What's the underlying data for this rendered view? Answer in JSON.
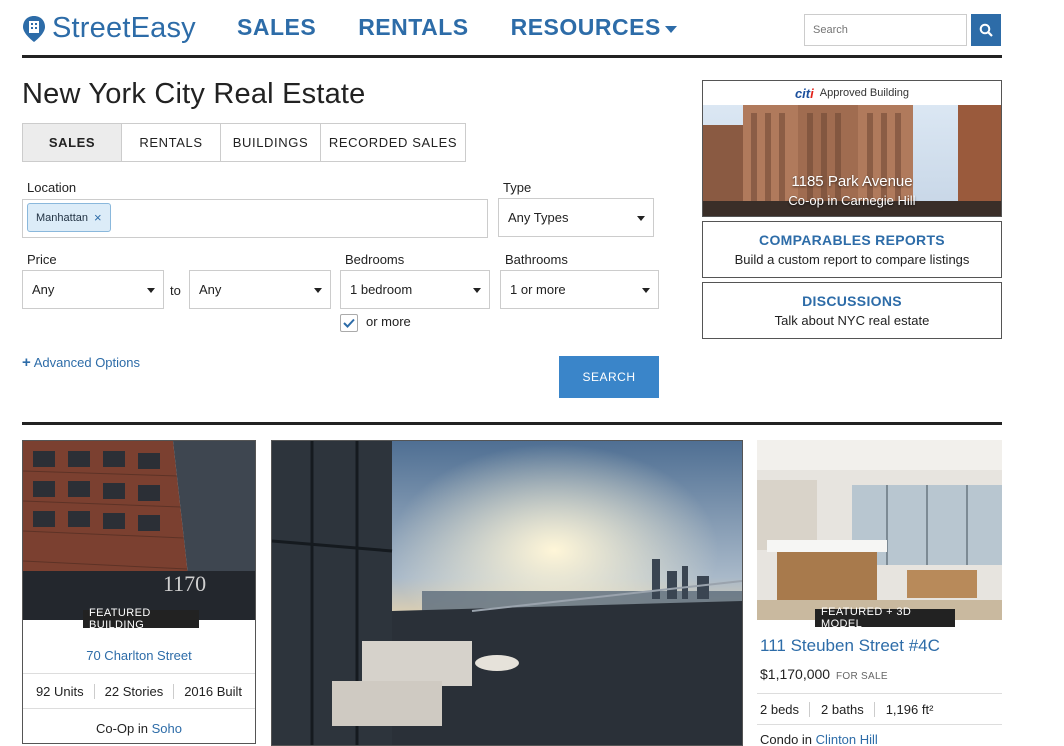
{
  "header": {
    "logo": "StreetEasy",
    "nav": [
      {
        "label": "SALES"
      },
      {
        "label": "RENTALS"
      },
      {
        "label": "RESOURCES"
      }
    ],
    "search_placeholder": "Search"
  },
  "page_title": "New York City Real Estate",
  "tabs": [
    {
      "label": "SALES",
      "active": true
    },
    {
      "label": "RENTALS",
      "active": false
    },
    {
      "label": "BUILDINGS",
      "active": false
    },
    {
      "label": "RECORDED SALES",
      "active": false
    }
  ],
  "form": {
    "location_label": "Location",
    "location_chip": "Manhattan",
    "type_label": "Type",
    "type_value": "Any Types",
    "price_label": "Price",
    "price_min": "Any",
    "to_label": "to",
    "price_max": "Any",
    "bedrooms_label": "Bedrooms",
    "bedrooms_value": "1 bedroom",
    "or_more_label": "or more",
    "or_more_checked": true,
    "bathrooms_label": "Bathrooms",
    "bathrooms_value": "1 or more",
    "advanced_label": "Advanced Options",
    "search_button": "SEARCH"
  },
  "promo": {
    "sponsor": "citi",
    "badge": "Approved Building",
    "title": "1185 Park Avenue",
    "subtitle": "Co-op in Carnegie Hill"
  },
  "links": [
    {
      "title": "COMPARABLES REPORTS",
      "desc": "Build a custom report to compare listings"
    },
    {
      "title": "DISCUSSIONS",
      "desc": "Talk about NYC real estate"
    }
  ],
  "featured_building": {
    "badge": "FEATURED BUILDING",
    "name": "70 Charlton Street",
    "units": "92 Units",
    "stories": "22 Stories",
    "built": "2016 Built",
    "type": "Co-Op in",
    "neighborhood": "Soho"
  },
  "featured_listing": {
    "badge": "FEATURED + 3D MODEL",
    "address": "111 Steuben Street #4C",
    "price": "$1,170,000",
    "price_status": "FOR SALE",
    "beds": "2 beds",
    "baths": "2 baths",
    "sqft": "1,196 ft²",
    "type": "Condo in",
    "neighborhood": "Clinton Hill"
  },
  "colors": {
    "brand": "#2d6ca8",
    "button": "#3a85c9",
    "rule": "#222222"
  }
}
